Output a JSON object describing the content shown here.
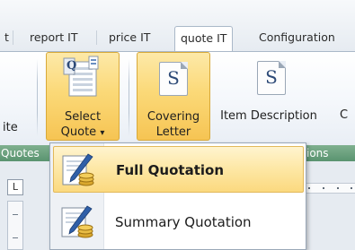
{
  "tabs": [
    {
      "label": "t"
    },
    {
      "label": "report IT"
    },
    {
      "label": "price IT"
    },
    {
      "label": "quote IT",
      "active": true
    },
    {
      "label": "Configuration"
    }
  ],
  "ribbon": {
    "clipped_label": "ite",
    "select_quote": {
      "line1": "Select",
      "line2": "Quote",
      "arrow": "▾"
    },
    "covering_letter": {
      "line1": "Covering",
      "line2": "Letter",
      "glyph": "S"
    },
    "item_description": {
      "line1": "Item Description",
      "glyph": "S"
    },
    "clipped_right": "C"
  },
  "group_bar": {
    "left": "Quotes",
    "right": "ions"
  },
  "workspace": {
    "ruler_corner": "L"
  },
  "menu": {
    "items": [
      {
        "label": "Full Quotation",
        "highlighted": true,
        "icon": "pen-and-coins-icon"
      },
      {
        "label": "Summary Quotation",
        "highlighted": false,
        "icon": "pen-and-coins-icon"
      }
    ]
  },
  "colors": {
    "highlight": "#fbd978",
    "group_bar": "#6aa07d",
    "tab_border": "#aab8c8"
  }
}
